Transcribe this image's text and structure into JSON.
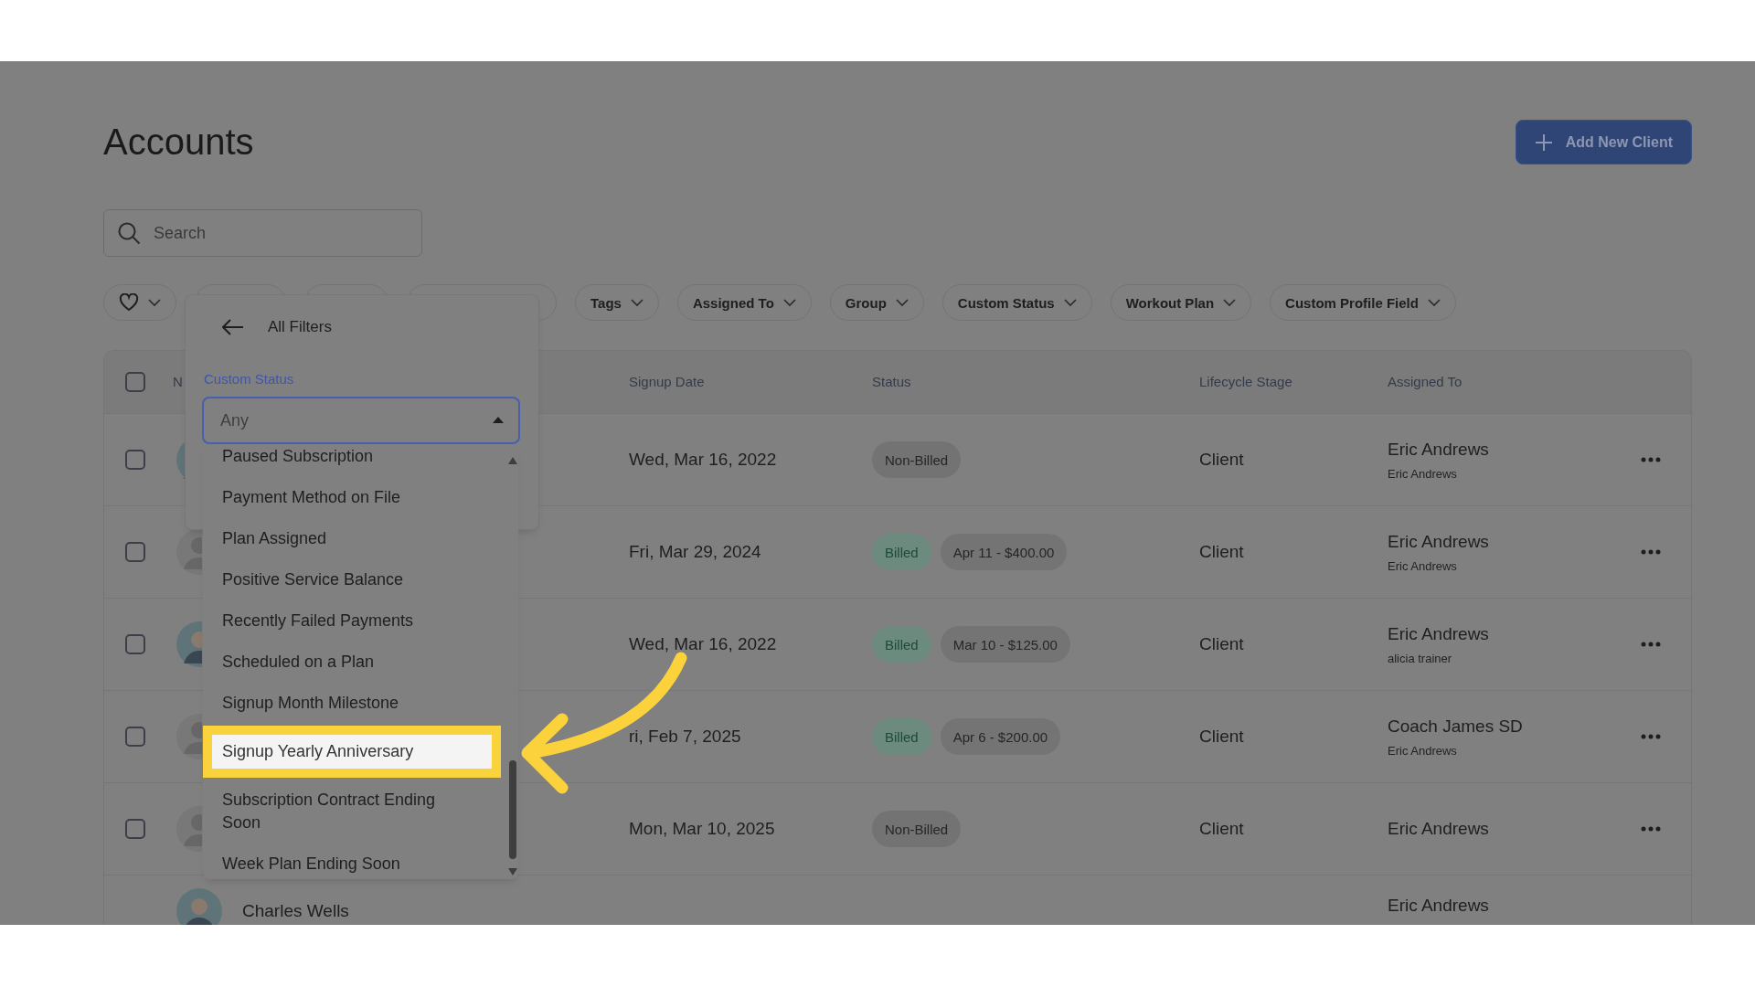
{
  "header": {
    "title": "Accounts",
    "add_button": "Add New Client"
  },
  "search": {
    "placeholder": "Search"
  },
  "filters": [
    {
      "kind": "favorites"
    },
    {
      "kind": "covered"
    },
    {
      "kind": "covered"
    },
    {
      "kind": "covered"
    },
    {
      "kind": "dropdown",
      "label": "Tags"
    },
    {
      "kind": "dropdown",
      "label": "Assigned To"
    },
    {
      "kind": "dropdown",
      "label": "Group"
    },
    {
      "kind": "dropdown",
      "label": "Custom Status"
    },
    {
      "kind": "dropdown",
      "label": "Workout Plan"
    },
    {
      "kind": "dropdown",
      "label": "Custom Profile Field"
    }
  ],
  "table": {
    "select_all": {
      "checked": false
    },
    "columns": [
      "N",
      "Signup Date",
      "Status",
      "Lifecycle Stage",
      "Assigned To"
    ],
    "rows": [
      {
        "checked": false,
        "avatar": {
          "kind": "photo"
        },
        "signup_date": "Wed, Mar 16, 2022",
        "billing": {
          "kind": "non_billed",
          "label": "Non-Billed"
        },
        "lifecycle": "Client",
        "assigned": "Eric Andrews",
        "assigned_sub": "Eric Andrews"
      },
      {
        "checked": false,
        "avatar": {
          "kind": "silhouette"
        },
        "signup_date": "Fri, Mar 29, 2024",
        "billing": {
          "kind": "billed",
          "label": "Billed"
        },
        "amount": "Apr 11 - $400.00",
        "lifecycle": "Client",
        "assigned": "Eric Andrews",
        "assigned_sub": "Eric Andrews"
      },
      {
        "checked": false,
        "avatar": {
          "kind": "photo"
        },
        "signup_date": "Wed, Mar 16, 2022",
        "billing": {
          "kind": "billed",
          "label": "Billed"
        },
        "amount": "Mar 10 - $125.00",
        "lifecycle": "Client",
        "assigned": "Eric Andrews",
        "assigned_sub": "alicia trainer"
      },
      {
        "checked": false,
        "avatar": {
          "kind": "silhouette"
        },
        "signup_date": "ri, Feb 7, 2025",
        "billing": {
          "kind": "billed",
          "label": "Billed"
        },
        "amount": "Apr 6 - $200.00",
        "lifecycle": "Client",
        "assigned": "Coach James SD",
        "assigned_sub": "Eric Andrews"
      },
      {
        "checked": false,
        "avatar": {
          "kind": "silhouette"
        },
        "signup_date": "Mon, Mar 10, 2025",
        "billing": {
          "kind": "non_billed",
          "label": "Non-Billed"
        },
        "lifecycle": "Client",
        "assigned": "Eric Andrews"
      },
      {
        "avatar": {
          "kind": "photo"
        },
        "name": "Charles Wells",
        "assigned": "Eric Andrews"
      }
    ]
  },
  "filter_panel": {
    "title": "All Filters",
    "field_label": "Custom Status",
    "select": {
      "placeholder": "Any",
      "expanded": true
    },
    "options": [
      {
        "label": "Paused Subscription",
        "highlighted": false
      },
      {
        "label": "Payment Method on File",
        "highlighted": false
      },
      {
        "label": "Plan Assigned",
        "highlighted": false
      },
      {
        "label": "Positive Service Balance",
        "highlighted": false
      },
      {
        "label": "Recently Failed Payments",
        "highlighted": false
      },
      {
        "label": "Scheduled on a Plan",
        "highlighted": false
      },
      {
        "label": "Signup Month Milestone",
        "highlighted": false
      },
      {
        "label": "Signup Yearly Anniversary",
        "highlighted": true
      },
      {
        "label": "Subscription Contract Ending Soon",
        "highlighted": false
      },
      {
        "label": "Week Plan Ending Soon",
        "highlighted": false
      }
    ]
  }
}
